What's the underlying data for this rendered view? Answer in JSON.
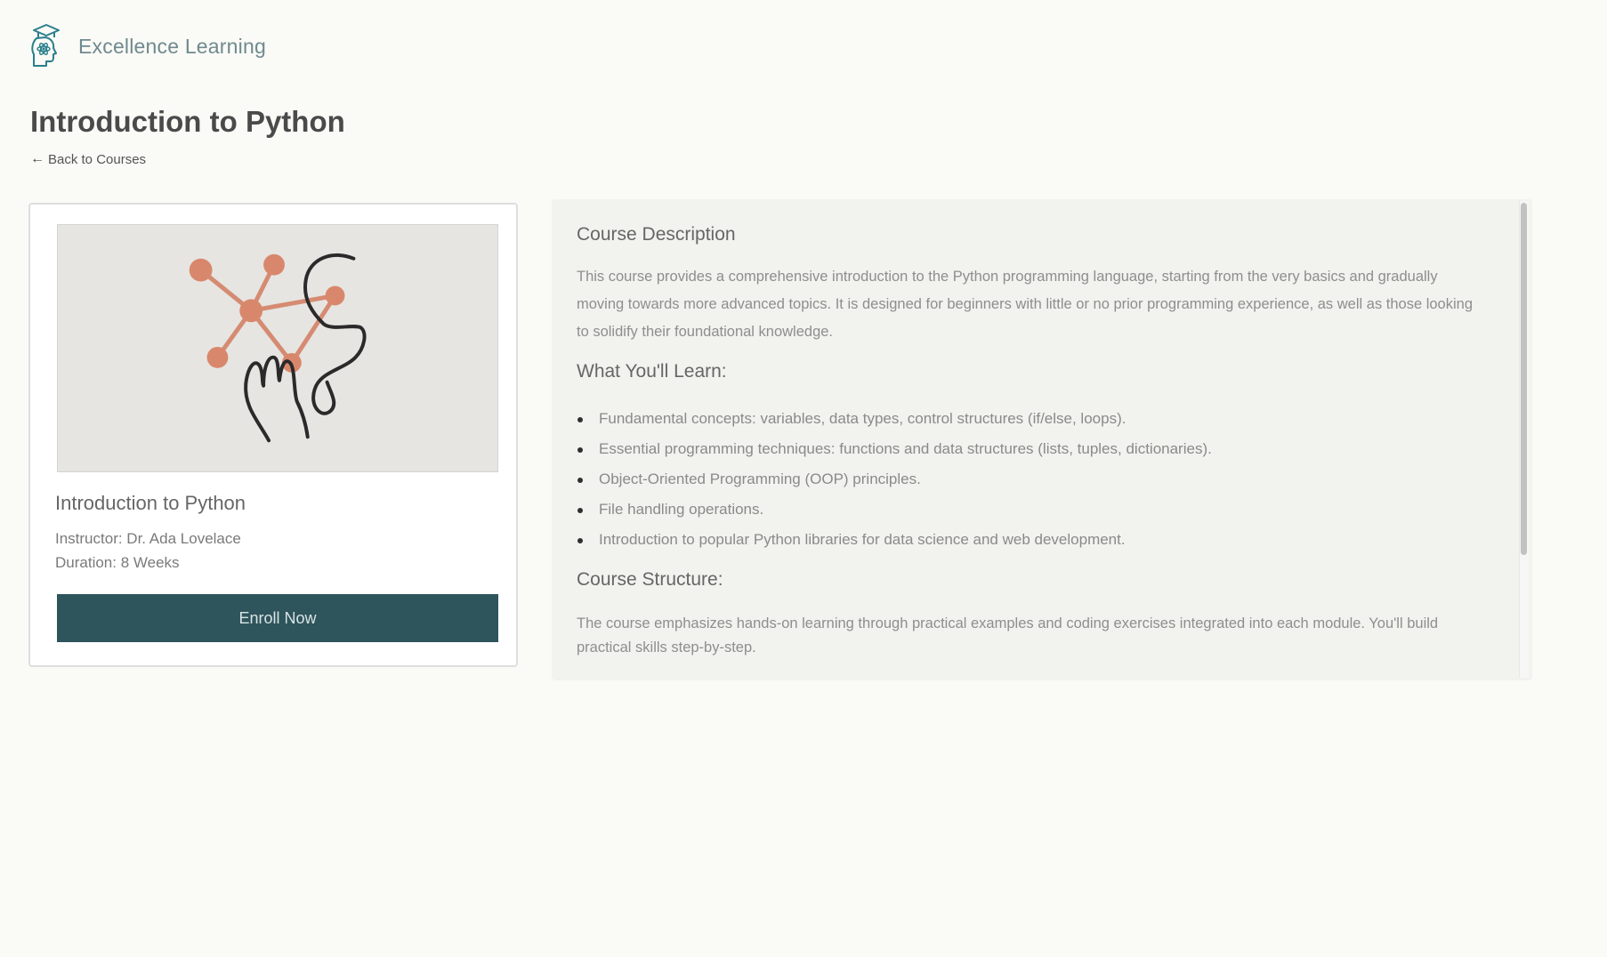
{
  "header": {
    "brand": "Excellence Learning",
    "logo_icon": "graduation-head-atom-icon",
    "brand_color": "#6f8a8e"
  },
  "page": {
    "title": "Introduction to Python",
    "back_link": "Back to Courses",
    "back_icon": "arrow-left-icon"
  },
  "course_card": {
    "image_alt": "molecule-and-hand-illustration",
    "title": "Introduction to Python",
    "instructor": "Instructor: Dr. Ada Lovelace",
    "duration": "Duration: 8 Weeks",
    "enroll_label": "Enroll Now",
    "accent_color": "#2e545c"
  },
  "description": {
    "heading": "Course Description",
    "text": "This course provides a comprehensive introduction to the Python programming language, starting from the very basics and  gradually moving towards more advanced topics. It is designed for beginners with little or no prior programming experience, as well as those looking to solidify their foundational knowledge.",
    "learn_heading": "What You'll Learn:",
    "learn_items": [
      "Fundamental concepts: variables, data types, control structures (if/else, loops).",
      "Essential programming techniques: functions and data structures (lists, tuples, dictionaries).",
      "Object-Oriented Programming (OOP) principles.",
      "File handling operations.",
      "Introduction to popular Python libraries for data science and web development."
    ],
    "structure_heading": "Course Structure:",
    "structure_text": "The course emphasizes hands-on learning through practical examples and coding exercises integrated into each module. You'll build practical skills step-by-step."
  }
}
